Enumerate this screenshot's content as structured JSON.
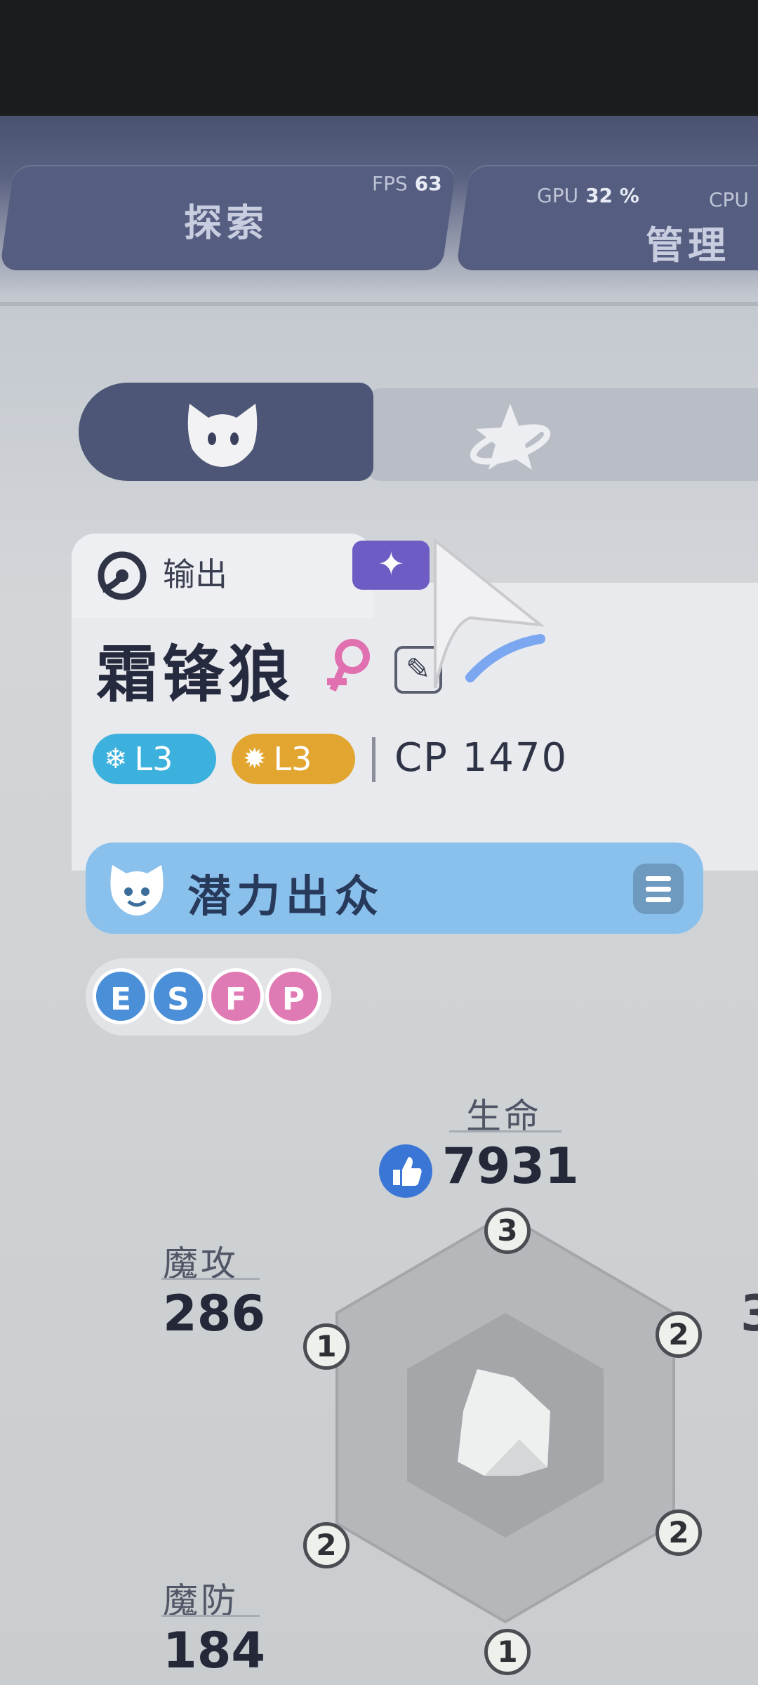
{
  "top_nav": {
    "explore_label": "探索",
    "manage_label": "管理",
    "fps_label": "FPS",
    "fps_value": "63",
    "gpu_label": "GPU",
    "gpu_value": "32 %",
    "cpu_label": "CPU"
  },
  "sub_tabs": [
    {
      "icon": "cat-face-icon",
      "active": true
    },
    {
      "icon": "planet-star-icon",
      "active": false
    }
  ],
  "character": {
    "role": "输出",
    "name": "霜锋狼",
    "gender": "female",
    "element_badges": [
      {
        "icon": "snowflake-icon",
        "label": "L3",
        "color": "#3db1dd"
      },
      {
        "icon": "sun-icon",
        "label": "L3",
        "color": "#e2a630"
      }
    ],
    "cp": "CP 1470"
  },
  "potential": {
    "label": "潜力出众"
  },
  "personality_letters": [
    {
      "letter": "E",
      "color": "#4a8fd8"
    },
    {
      "letter": "S",
      "color": "#4a8fd8"
    },
    {
      "letter": "F",
      "color": "#e07ab4"
    },
    {
      "letter": "P",
      "color": "#e07ab4"
    }
  ],
  "stats": {
    "hp_label": "生命",
    "hp_value": "7931",
    "matk_label": "魔攻",
    "matk_value": "286",
    "mdef_label": "魔防",
    "mdef_value": "184"
  },
  "hex_levels": {
    "top": "3",
    "upper_left": "1",
    "upper_right": "2",
    "lower_left": "2",
    "lower_right": "2",
    "bottom": "1"
  }
}
